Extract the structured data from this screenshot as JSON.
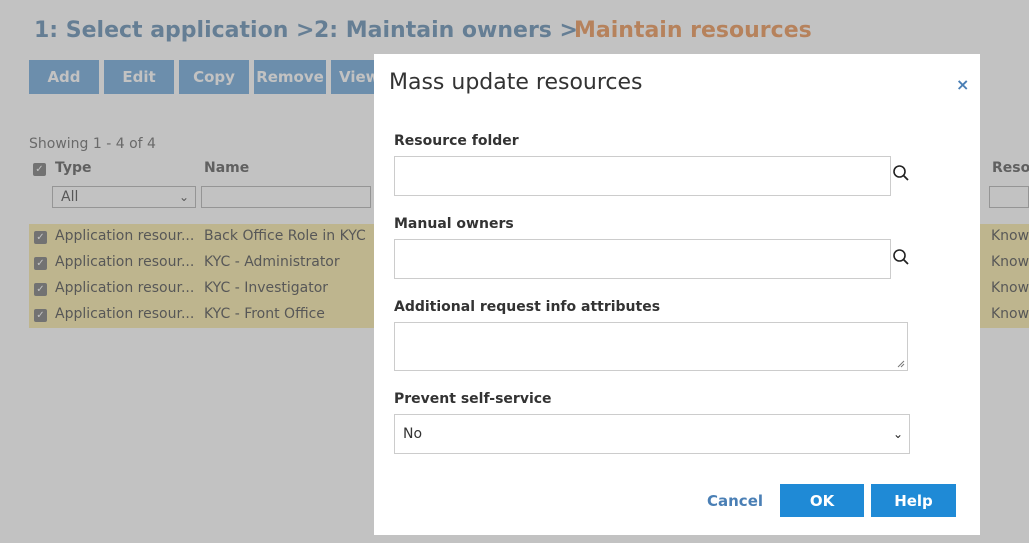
{
  "breadcrumb": {
    "step1": "1: Select application >",
    "step2": "2: Maintain owners >",
    "step3": "Maintain resources"
  },
  "toolbar": {
    "add": "Add",
    "edit": "Edit",
    "copy": "Copy",
    "remove": "Remove",
    "view": "View"
  },
  "list": {
    "showing": "Showing 1 - 4 of 4",
    "columns": {
      "type": "Type",
      "name": "Name",
      "resource": "Resou"
    },
    "type_filter": "All",
    "rows": [
      {
        "type": "Application resour...",
        "name": "Back Office Role in KYC",
        "resource": "Know"
      },
      {
        "type": "Application resour...",
        "name": "KYC - Administrator",
        "resource": "Know"
      },
      {
        "type": "Application resour...",
        "name": "KYC - Investigator",
        "resource": "Know"
      },
      {
        "type": "Application resour...",
        "name": "KYC - Front Office",
        "resource": "Know"
      }
    ]
  },
  "modal": {
    "title": "Mass update resources",
    "close": "×",
    "resource_folder_label": "Resource folder",
    "resource_folder_value": "",
    "manual_owners_label": "Manual owners",
    "manual_owners_value": "",
    "additional_info_label": "Additional request info attributes",
    "additional_info_value": "",
    "prevent_self_service_label": "Prevent self-service",
    "prevent_self_service_value": "No",
    "cancel": "Cancel",
    "ok": "OK",
    "help": "Help"
  },
  "colors": {
    "step_done": "#4d7ea8",
    "step_active": "#e8853d",
    "toolbar_button": "#5b9bd5",
    "primary_button": "#1f8ad6",
    "row_highlight": "#f7e79c"
  }
}
